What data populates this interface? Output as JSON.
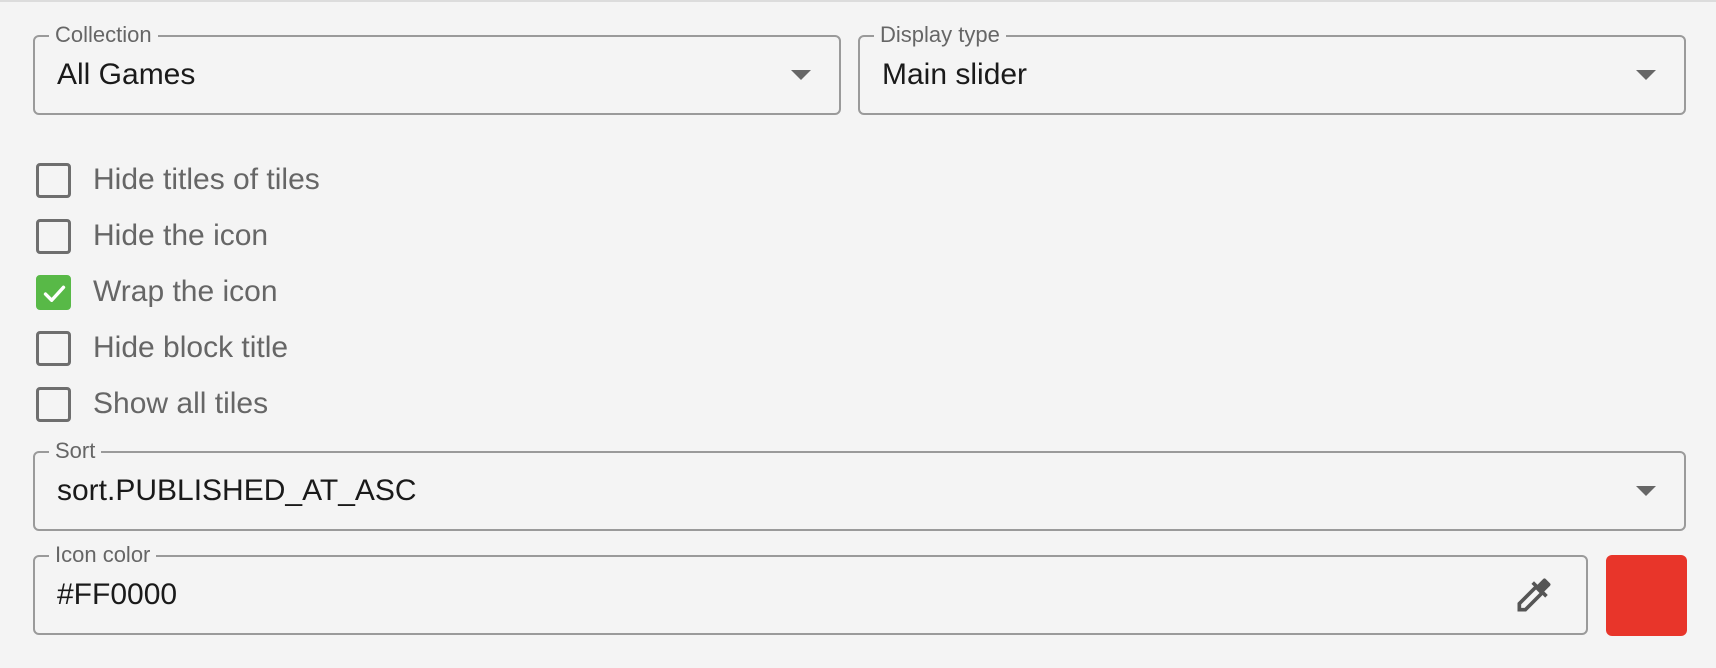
{
  "collection": {
    "label": "Collection",
    "value": "All Games"
  },
  "display_type": {
    "label": "Display type",
    "value": "Main slider"
  },
  "checkboxes": [
    {
      "label": "Hide titles of tiles",
      "checked": false
    },
    {
      "label": "Hide the icon",
      "checked": false
    },
    {
      "label": "Wrap the icon",
      "checked": true
    },
    {
      "label": "Hide block title",
      "checked": false
    },
    {
      "label": "Show all tiles",
      "checked": false
    }
  ],
  "sort": {
    "label": "Sort",
    "value": "sort.PUBLISHED_AT_ASC"
  },
  "icon_color": {
    "label": "Icon color",
    "value": "#FF0000",
    "swatch_color": "#e8352a",
    "picker_icon": "eyedropper-icon"
  },
  "colors": {
    "checkbox_checked": "#58b947",
    "border": "#9a9a9a",
    "background": "#f4f4f4"
  }
}
